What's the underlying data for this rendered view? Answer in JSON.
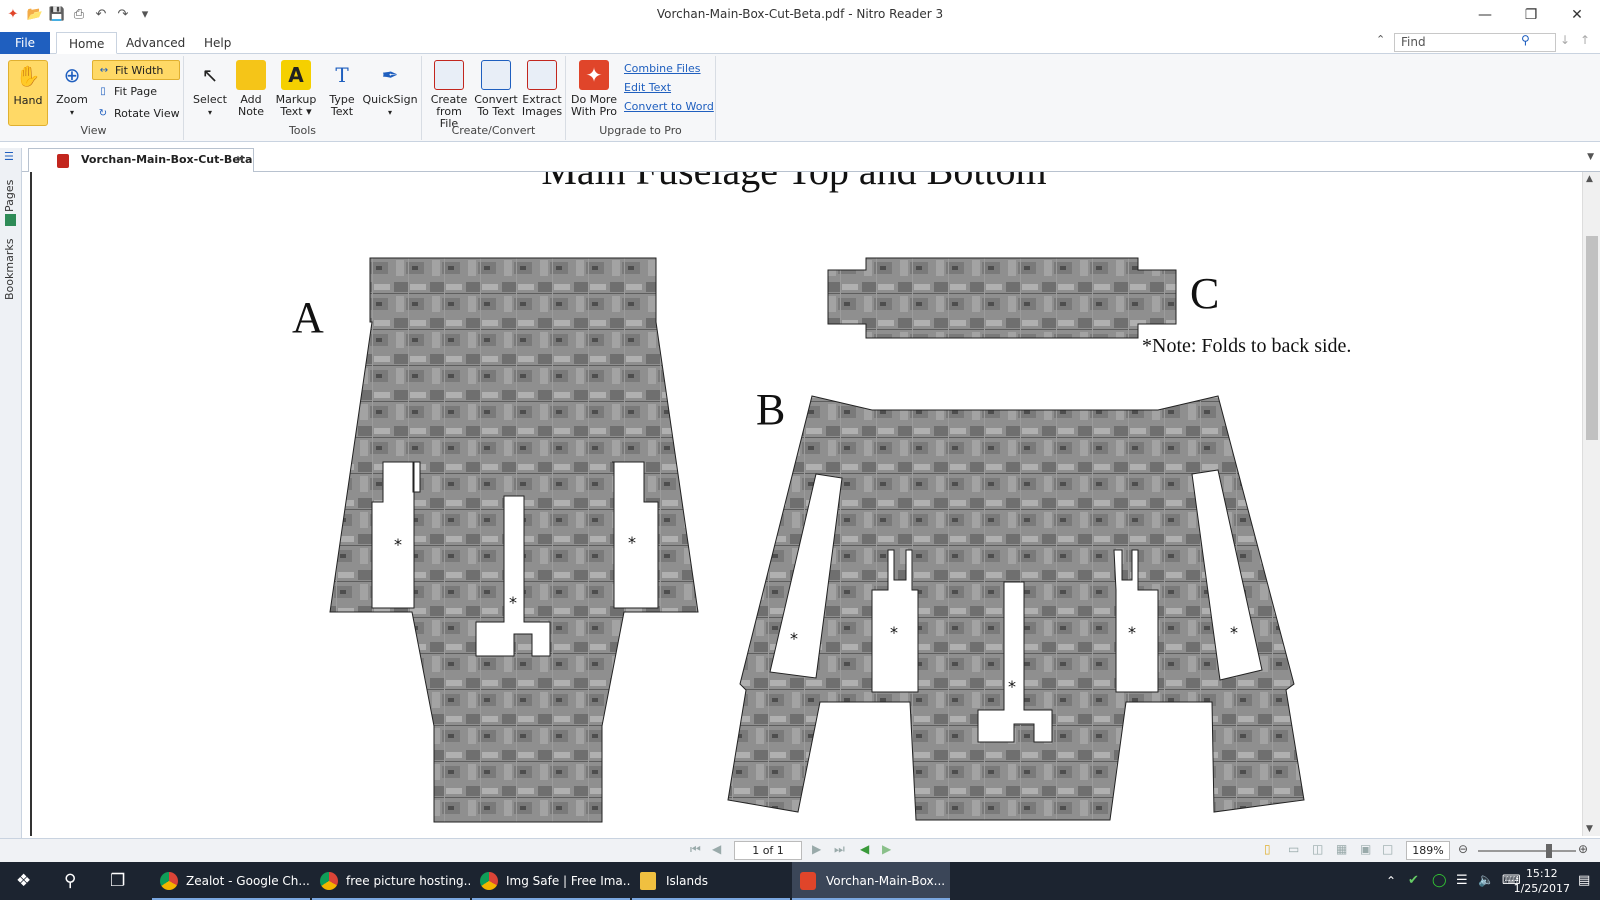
{
  "window": {
    "title": "Vorchan-Main-Box-Cut-Beta.pdf - Nitro Reader 3",
    "controls": [
      "—",
      "❐",
      "✕"
    ]
  },
  "ribbon_tabs": {
    "file": "File",
    "home": "Home",
    "advanced": "Advanced",
    "help": "Help"
  },
  "find": {
    "placeholder": "Find"
  },
  "ribbon": {
    "view": {
      "label": "View",
      "hand": "Hand",
      "zoom": "Zoom",
      "fit_width": "Fit Width",
      "fit_page": "Fit Page",
      "rotate_view": "Rotate View"
    },
    "tools": {
      "label": "Tools",
      "select": "Select",
      "add_note": [
        "Add",
        "Note"
      ],
      "markup_text": [
        "Markup",
        "Text ▾"
      ],
      "type_text": [
        "Type",
        "Text"
      ],
      "quicksign": "QuickSign"
    },
    "create_convert": {
      "label": "Create/Convert",
      "create_from_file": [
        "Create",
        "from File"
      ],
      "convert_to_text": [
        "Convert",
        "To Text"
      ],
      "extract_images": [
        "Extract",
        "Images"
      ]
    },
    "upgrade": {
      "label": "Upgrade to Pro",
      "do_more": [
        "Do More",
        "With Pro"
      ],
      "combine_files": "Combine Files",
      "edit_text": "Edit Text",
      "convert_to_word": "Convert to Word"
    }
  },
  "document_tab": {
    "name": "Vorchan-Main-Box-Cut-Beta"
  },
  "sidebar": {
    "pages": "Pages",
    "bookmarks": "Bookmarks"
  },
  "document": {
    "heading": "Main Fuselage Top and Bottom",
    "label_a": "A",
    "label_b": "B",
    "label_c": "C",
    "note": "*Note: Folds to back side.",
    "fold_mark": "*"
  },
  "statusbar": {
    "page": "1 of 1",
    "zoom": "189%"
  },
  "taskbar": {
    "items": [
      "Zealot - Google Ch...",
      "free picture hosting...",
      "Img Safe | Free Ima...",
      "Islands",
      "Vorchan-Main-Box..."
    ],
    "time": "15:12",
    "date": "1/25/2017"
  },
  "colors": {
    "accent": "#1f5fbf",
    "highlight": "#ffd966",
    "taskbar": "#1c2430"
  }
}
